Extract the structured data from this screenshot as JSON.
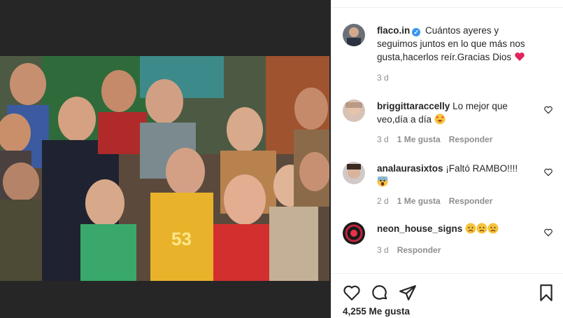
{
  "post": {
    "author": "flaco.in",
    "verified_symbol": "✓",
    "caption": "Cuántos ayeres y seguimos juntos en lo que más nos gusta,hacerlos reír.Gracias Dios",
    "caption_emoji": "red-heart",
    "time": "3 d",
    "likes": "4,255 Me gusta"
  },
  "comments": [
    {
      "username": "briggittaraccelly",
      "text": "Lo mejor que veo,día a día",
      "emoji": "heart-eyes",
      "time": "3 d",
      "likes": "1 Me gusta",
      "reply": "Responder"
    },
    {
      "username": "analaurasixtos",
      "text": "¡Faltó RAMBO!!!!",
      "emoji": "screaming-face",
      "time": "2 d",
      "likes": "1 Me gusta",
      "reply": "Responder"
    },
    {
      "username": "neon_house_signs",
      "text": "",
      "emoji": "sad-face x3",
      "time": "3 d",
      "reply": "Responder"
    }
  ],
  "icons": {
    "like": "heart-outline-icon",
    "comment": "comment-bubble-icon",
    "share": "paper-plane-icon",
    "save": "bookmark-icon"
  },
  "colors": {
    "accent_verified": "#3897f0",
    "text": "#262626",
    "muted": "#8e8e8e",
    "heart": "#ed4956"
  }
}
